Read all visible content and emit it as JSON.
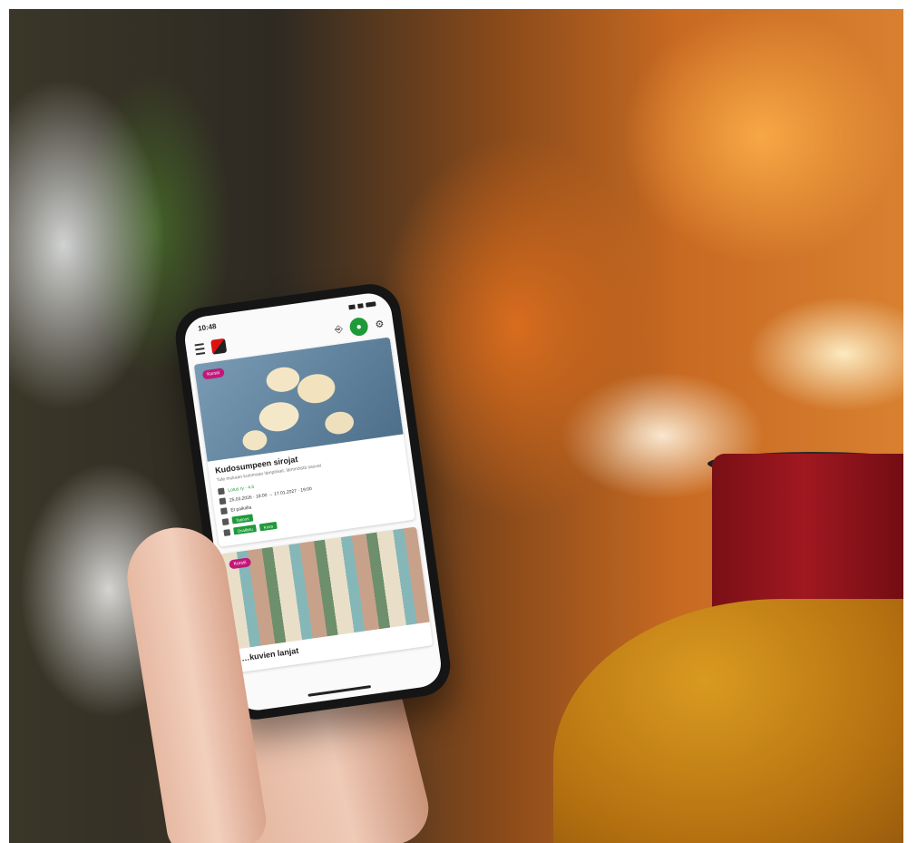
{
  "status_bar": {
    "time": "10:48"
  },
  "cards": [
    {
      "badge": "Kurssi",
      "title": "Kudosumpeen sirojat",
      "description": "Tule mukaan kutomaan lämpöiset, lämmöistä sauvat",
      "organizer": "Lotus ry · 4.6",
      "dates": "25.03.2026 · 18:00 → 17.01.2027 · 19:00",
      "location": "Et paikalla",
      "chips_row1": [
        "Tarjous"
      ],
      "chips_row2": [
        "Osallistu",
        "Kuva"
      ]
    },
    {
      "badge": "Kurssi",
      "title": "…kuvien lanjat"
    }
  ],
  "icons": {
    "menu": "menu-icon",
    "logo": "app-logo",
    "login": "login-icon",
    "user": "user-icon",
    "settings": "gear-icon"
  },
  "colors": {
    "accent": "#1f9a3a",
    "badge": "#c2187a"
  }
}
